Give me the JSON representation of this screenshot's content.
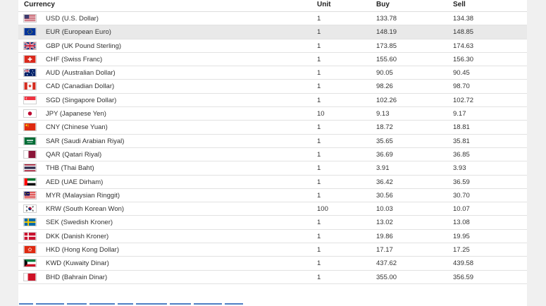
{
  "table": {
    "headers": {
      "currency": "Currency",
      "unit": "Unit",
      "buy": "Buy",
      "sell": "Sell"
    },
    "rows": [
      {
        "flag": "us-flag-icon",
        "name": "USD (U.S. Dollar)",
        "unit": "1",
        "buy": "133.78",
        "sell": "134.38"
      },
      {
        "flag": "eu-flag-icon",
        "name": "EUR (European Euro)",
        "unit": "1",
        "buy": "148.19",
        "sell": "148.85"
      },
      {
        "flag": "gb-flag-icon",
        "name": "GBP (UK Pound Sterling)",
        "unit": "1",
        "buy": "173.85",
        "sell": "174.63"
      },
      {
        "flag": "ch-flag-icon",
        "name": "CHF (Swiss Franc)",
        "unit": "1",
        "buy": "155.60",
        "sell": "156.30"
      },
      {
        "flag": "au-flag-icon",
        "name": "AUD (Australian Dollar)",
        "unit": "1",
        "buy": "90.05",
        "sell": "90.45"
      },
      {
        "flag": "ca-flag-icon",
        "name": "CAD (Canadian Dollar)",
        "unit": "1",
        "buy": "98.26",
        "sell": "98.70"
      },
      {
        "flag": "sg-flag-icon",
        "name": "SGD (Singapore Dollar)",
        "unit": "1",
        "buy": "102.26",
        "sell": "102.72"
      },
      {
        "flag": "jp-flag-icon",
        "name": "JPY (Japanese Yen)",
        "unit": "10",
        "buy": "9.13",
        "sell": "9.17"
      },
      {
        "flag": "cn-flag-icon",
        "name": "CNY (Chinese Yuan)",
        "unit": "1",
        "buy": "18.72",
        "sell": "18.81"
      },
      {
        "flag": "sa-flag-icon",
        "name": "SAR (Saudi Arabian Riyal)",
        "unit": "1",
        "buy": "35.65",
        "sell": "35.81"
      },
      {
        "flag": "qa-flag-icon",
        "name": "QAR (Qatari Riyal)",
        "unit": "1",
        "buy": "36.69",
        "sell": "36.85"
      },
      {
        "flag": "th-flag-icon",
        "name": "THB (Thai Baht)",
        "unit": "1",
        "buy": "3.91",
        "sell": "3.93"
      },
      {
        "flag": "ae-flag-icon",
        "name": "AED (UAE Dirham)",
        "unit": "1",
        "buy": "36.42",
        "sell": "36.59"
      },
      {
        "flag": "my-flag-icon",
        "name": "MYR (Malaysian Ringgit)",
        "unit": "1",
        "buy": "30.56",
        "sell": "30.70"
      },
      {
        "flag": "kr-flag-icon",
        "name": "KRW (South Korean Won)",
        "unit": "100",
        "buy": "10.03",
        "sell": "10.07"
      },
      {
        "flag": "se-flag-icon",
        "name": "SEK (Swedish Kroner)",
        "unit": "1",
        "buy": "13.02",
        "sell": "13.08"
      },
      {
        "flag": "dk-flag-icon",
        "name": "DKK (Danish Kroner)",
        "unit": "1",
        "buy": "19.86",
        "sell": "19.95"
      },
      {
        "flag": "hk-flag-icon",
        "name": "HKD (Hong Kong Dollar)",
        "unit": "1",
        "buy": "17.17",
        "sell": "17.25"
      },
      {
        "flag": "kw-flag-icon",
        "name": "KWD (Kuwaity Dinar)",
        "unit": "1",
        "buy": "437.62",
        "sell": "439.58"
      },
      {
        "flag": "bh-flag-icon",
        "name": "BHD (Bahrain Dinar)",
        "unit": "1",
        "buy": "355.00",
        "sell": "356.59"
      }
    ],
    "highlighted_row": 1
  },
  "colors": {
    "header_text": "#222222",
    "row_text": "#333333",
    "row_highlight": "#e9e9e9",
    "row_border": "#e2e2e2",
    "side_bg": "#f0f0f0",
    "footnote_link": "#4d7fc4"
  }
}
